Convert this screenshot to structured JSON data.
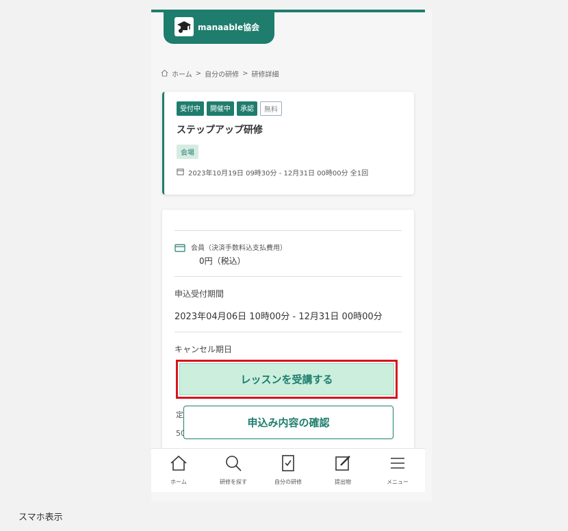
{
  "header": {
    "logo_text": "manaable協会",
    "logo_icon": "graduation-cap-icon",
    "accent_color": "#1e7d6d"
  },
  "breadcrumb": {
    "icon": "home-outline-icon",
    "items": [
      "ホーム",
      "自分の研修",
      "研修詳細"
    ],
    "separator": ">"
  },
  "course": {
    "tags": [
      "受付中",
      "開催中",
      "承認",
      "無料"
    ],
    "title": "ステップアップ研修",
    "venue": "会場",
    "schedule": "2023年10月19日 09時30分 - 12月31日 00時00分 全1回"
  },
  "details": {
    "fee_label": "会員（決済手数料込支払費用）",
    "fee_value": "0円（税込）",
    "application_period_label": "申込受付期間",
    "application_period_value": "2023年04月06日 10時00分 - 12月31日 00時00分",
    "cancel_deadline_label": "キャンセル期日",
    "partial_label": "定",
    "partial_value": "50"
  },
  "actions": {
    "primary_label": "レッスンを受講する",
    "secondary_label": "申込み内容の確認",
    "highlight_color": "#d9121b"
  },
  "tabbar": {
    "items": [
      {
        "label": "ホーム",
        "icon": "home-icon"
      },
      {
        "label": "研修を探す",
        "icon": "search-icon"
      },
      {
        "label": "自分の研修",
        "icon": "bookmark-check-icon"
      },
      {
        "label": "提出物",
        "icon": "edit-icon"
      },
      {
        "label": "メニュー",
        "icon": "menu-icon"
      }
    ]
  },
  "caption": "スマホ表示"
}
